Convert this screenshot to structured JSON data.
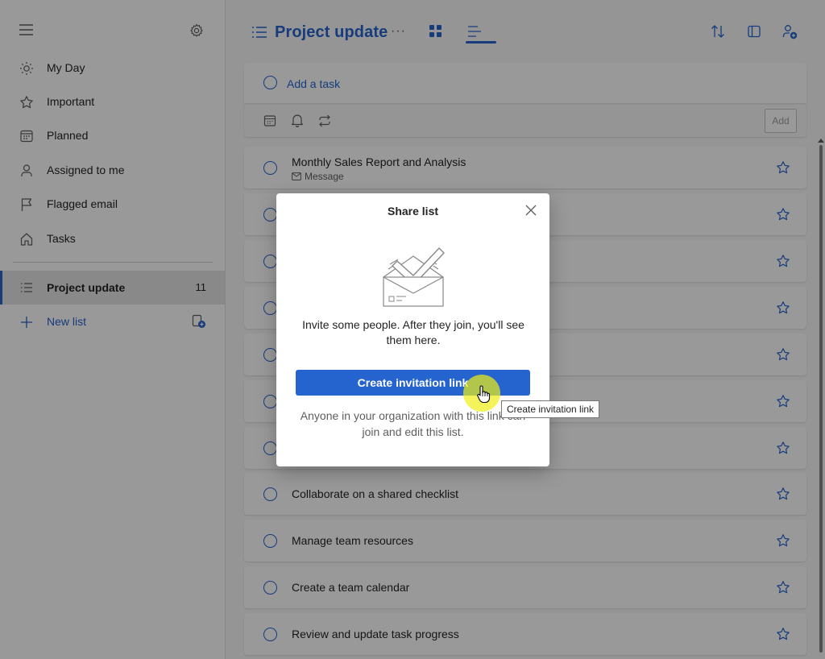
{
  "sidebar": {
    "items": [
      {
        "label": "My Day",
        "icon": "sun-icon"
      },
      {
        "label": "Important",
        "icon": "star-icon"
      },
      {
        "label": "Planned",
        "icon": "calendar-icon"
      },
      {
        "label": "Assigned to me",
        "icon": "person-icon"
      },
      {
        "label": "Flagged email",
        "icon": "flag-icon"
      },
      {
        "label": "Tasks",
        "icon": "home-icon"
      }
    ],
    "lists": [
      {
        "label": "Project update",
        "count": "11",
        "icon": "list-icon"
      }
    ],
    "new_list_label": "New list"
  },
  "header": {
    "title": "Project update",
    "more": "···"
  },
  "add_task": {
    "placeholder": "Add a task",
    "add_button": "Add"
  },
  "tasks": [
    {
      "title": "Monthly Sales Report and Analysis",
      "sub": "Message"
    },
    {
      "title": ""
    },
    {
      "title": ""
    },
    {
      "title": ""
    },
    {
      "title": ""
    },
    {
      "title": ""
    },
    {
      "title": ""
    },
    {
      "title": "Collaborate on a shared checklist"
    },
    {
      "title": "Manage team resources"
    },
    {
      "title": "Create a team calendar"
    },
    {
      "title": "Review and update task progress"
    }
  ],
  "dialog": {
    "title": "Share list",
    "text": "Invite some people. After they join, you'll see them here.",
    "button": "Create invitation link",
    "note": "Anyone in your organization with this link can join and edit this list.",
    "tooltip": "Create invitation link"
  },
  "colors": {
    "accent": "#2564cf",
    "overlay": "rgba(0,0,0,0.4)"
  }
}
